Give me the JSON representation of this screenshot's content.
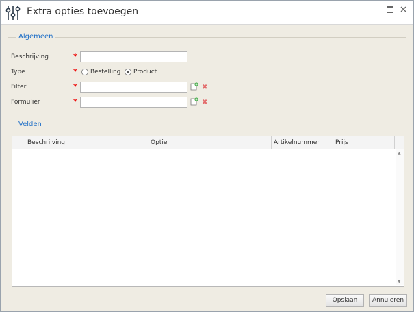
{
  "window": {
    "title": "Extra opties toevoegen"
  },
  "sections": {
    "general": "Algemeen",
    "fields": "Velden"
  },
  "form": {
    "description_label": "Beschrijving",
    "type_label": "Type",
    "filter_label": "Filter",
    "form_label": "Formulier",
    "required_mark": "*",
    "description_value": "",
    "filter_value": "",
    "form_value": "",
    "type_options": [
      "Bestelling",
      "Product"
    ],
    "type_selected": "Product"
  },
  "grid": {
    "columns": [
      "Beschrijving",
      "Optie",
      "Artikelnummer",
      "Prijs"
    ],
    "rows": []
  },
  "buttons": {
    "save": "Opslaan",
    "cancel": "Annuleren"
  },
  "icons": {
    "app": "adjust-sliders-icon",
    "maximize": "maximize-icon",
    "close": "close-icon",
    "edit": "edit-add-icon",
    "delete": "delete-x-icon"
  },
  "colors": {
    "accent": "#1f6fc7",
    "required": "#ee0000",
    "delete": "#e36d6d",
    "edit_plus": "#4caf50"
  }
}
